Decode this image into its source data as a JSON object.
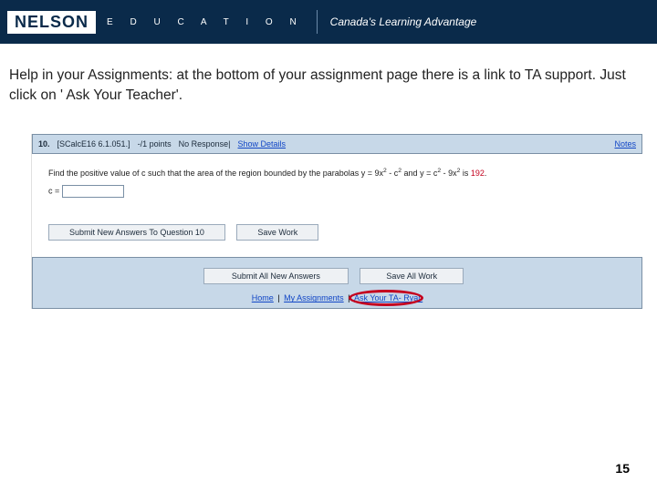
{
  "header": {
    "brand": "NELSON",
    "education": "E D U C A T I O N",
    "tagline": "Canada's Learning Advantage"
  },
  "blurb": "Help in your Assignments: at the bottom of your assignment page there is a link to TA support. Just click on ' Ask Your Teacher'.",
  "question": {
    "num": "10.",
    "ref": "[SCalcE16 6.1.051.]",
    "pts": "-/1 points",
    "resp": "No Response",
    "show": "Show Details",
    "notes": "Notes",
    "prob_a": "Find the positive value of c such that the area of the region bounded by the parabolas y = ",
    "eq1a": "9x",
    "eq1b": " - c",
    "prob_and": " and y = c",
    "eq2a": " - 9x",
    "prob_end": " is ",
    "val": "192",
    "clabel": "c = "
  },
  "buttons": {
    "submit_q": "Submit New Answers To Question 10",
    "save_q": "Save Work",
    "submit_all": "Submit All New Answers",
    "save_all": "Save All Work"
  },
  "footer_links": {
    "home": "Home",
    "my": "My Assignments",
    "ask": "Ask Your TA- Ryan"
  },
  "page_number": "15"
}
